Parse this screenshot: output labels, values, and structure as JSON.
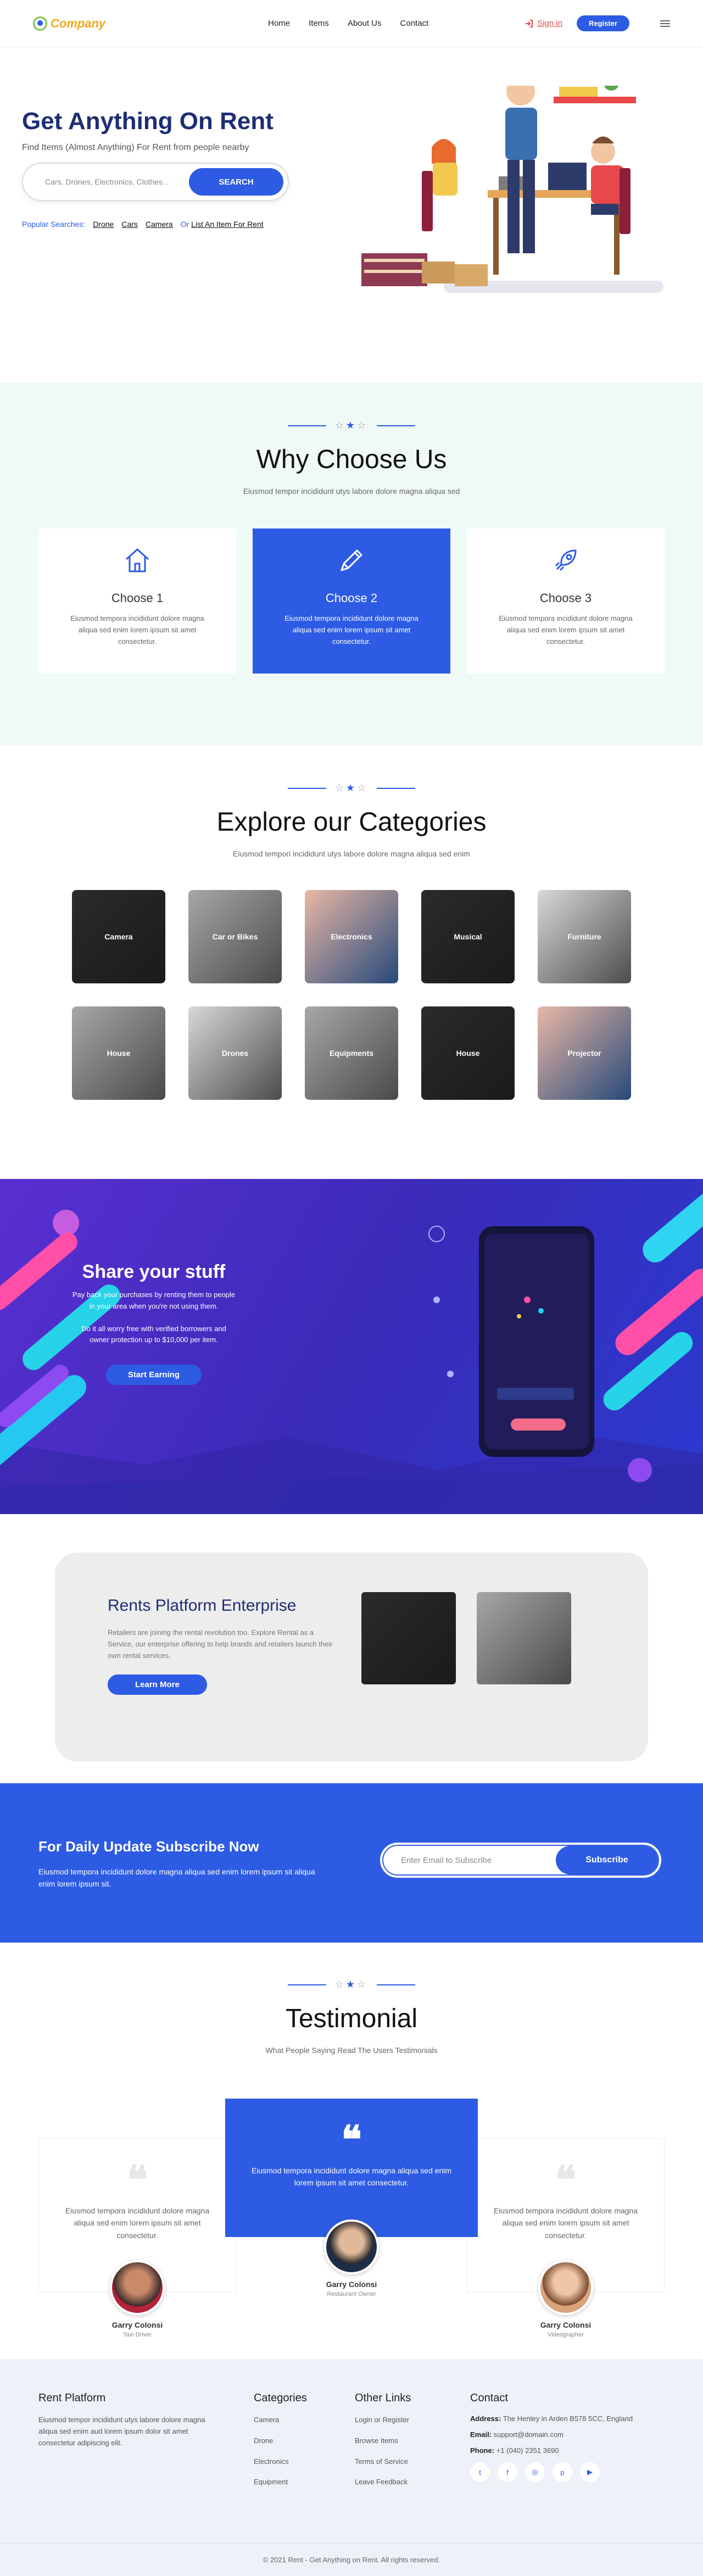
{
  "nav": {
    "logo": "Company",
    "menu": [
      "Home",
      "Items",
      "About Us",
      "Contact"
    ],
    "signin": "Sign in",
    "register": "Register"
  },
  "hero": {
    "title": "Get Anything On Rent",
    "subtitle": "Find Items (Almost Anything) For Rent from people nearby",
    "search_placeholder": "Cars, Drones, Electronics, Clothes...",
    "search_button": "SEARCH",
    "popular_label": "Popular Searches:",
    "popular_tags": [
      "Drone",
      "Cars",
      "Camera"
    ],
    "or_label": "Or",
    "list_link": "List An Item For Rent"
  },
  "why": {
    "title": "Why Choose Us",
    "subtitle": "Eiusmod tempor incididunt utys labore dolore magna aliqua sed",
    "cards": [
      {
        "icon": "home-icon",
        "title": "Choose 1",
        "text": "Eiusmod tempora incididunt dolore magna aliqua sed enim lorem ipsum sit amet consectetur."
      },
      {
        "icon": "pencil-icon",
        "title": "Choose 2",
        "text": "Eiusmod tempora incididunt dolore magna aliqua sed enim lorem ipsum sit amet consectetur."
      },
      {
        "icon": "rocket-icon",
        "title": "Choose 3",
        "text": "Eiusmod tempora incididunt dolore magna aliqua sed enim lorem ipsum sit amet consectetur."
      }
    ]
  },
  "categories": {
    "title": "Explore our Categories",
    "subtitle": "Eiusmod tempori incididunt utys labore dolore magna aliqua sed enim",
    "items": [
      "Camera",
      "Car or Bikes",
      "Electronics",
      "Musical",
      "Furniture",
      "House",
      "Drones",
      "Equipments",
      "House",
      "Projector"
    ]
  },
  "share": {
    "title": "Share your stuff",
    "text1": "Pay back your purchases by renting them to people in your area when you're not using them.",
    "text2": "Do it all worry free with verified borrowers and owner protection up to $10,000 per item.",
    "button": "Start Earning"
  },
  "enterprise": {
    "title": "Rents Platform Enterprise",
    "text": "Retailers are joining the rental revolution too. Explore Rental as a Service, our enterprise offering to help brands and retailers launch their own rental services.",
    "button": "Learn More"
  },
  "subscribe": {
    "title": "For Daily Update Subscribe Now",
    "text": "Eiusmod tempora incididunt dolore magna aliqua sed enim lorem ipsum sit aliqua enim lorem ipsum sit.",
    "placeholder": "Enter Email to Subscribe",
    "button": "Subscribe"
  },
  "testimonial": {
    "title": "Testimonial",
    "subtitle": "What People Saying Read The Users Testimonials",
    "items": [
      {
        "text": "Eiusmod tempora incididunt dolore magna aliqua sed enim lorem ipsum sit amet consectetur.",
        "name": "Garry Colonsi",
        "role": "Taxi Driver"
      },
      {
        "text": "Eiusmod tempora incididunt dolore magna aliqua sed enim lorem ipsum sit amet consectetur.",
        "name": "Garry Colonsi",
        "role": "Restaurant Owner"
      },
      {
        "text": "Eiusmod tempora incididunt dolore magna aliqua sed enim lorem ipsum sit amet consectetur.",
        "name": "Garry Colonsi",
        "role": "Videographer"
      }
    ]
  },
  "footer": {
    "about_title": "Rent Platform",
    "about_text": "Eiusmod tempor incididunt utys labore dolore magna aliqua sed enim aud lorem ipsum dolor sit amet consectetur adipiscing elit.",
    "cat_title": "Categories",
    "cat_links": [
      "Camera",
      "Drone",
      "Electronics",
      "Equipment"
    ],
    "other_title": "Other Links",
    "other_links": [
      "Login or Register",
      "Browse Items",
      "Terms of Service",
      "Leave Feedback"
    ],
    "contact_title": "Contact",
    "address_label": "Address:",
    "address": "The Henley in Arden B578 5CC, England",
    "email_label": "Email:",
    "email": "support@domain.com",
    "phone_label": "Phone:",
    "phone": "+1 (040) 2351 3690",
    "socials": [
      "twitter-icon",
      "facebook-icon",
      "instagram-icon",
      "pinterest-icon",
      "youtube-icon"
    ],
    "copyright": "© 2021 Rent - Get Anything on Rent. All rights reserved."
  },
  "colors": {
    "primary": "#2d5be3",
    "heading": "#1d2e74",
    "why_bg": "#effaf7",
    "footer_bg": "#eef1f8"
  }
}
